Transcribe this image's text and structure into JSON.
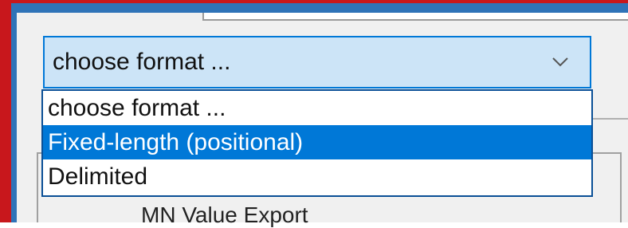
{
  "combo": {
    "value": "choose format ...",
    "icon": "chevron-down-icon"
  },
  "dropdown": {
    "options": [
      {
        "label": "choose format ...",
        "selected": false
      },
      {
        "label": "Fixed-length (positional)",
        "selected": true
      },
      {
        "label": "Delimited",
        "selected": false
      }
    ]
  },
  "background_panel": {
    "label": "MN Value Export"
  },
  "colors": {
    "frame": "#c8171c",
    "window_border": "#2f73b8",
    "combo_bg": "#cce4f7",
    "combo_border": "#0078d7",
    "selection": "#0078d7"
  }
}
